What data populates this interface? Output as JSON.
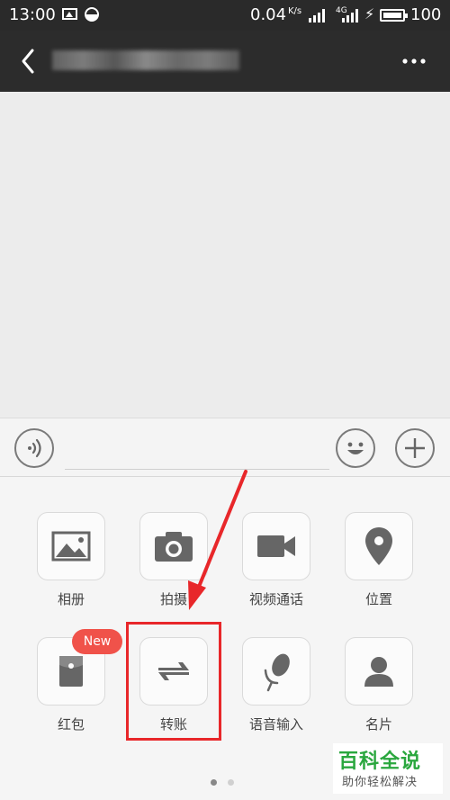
{
  "status_bar": {
    "time": "13:00",
    "speed": "0.04",
    "speed_unit": "K/s",
    "network": "4G",
    "battery": "100"
  },
  "header": {
    "back_icon": "chevron-left-icon",
    "more_icon": "more-horizontal-icon"
  },
  "input_bar": {
    "voice_icon": "voice-icon",
    "emoji_icon": "emoji-icon",
    "plus_icon": "plus-icon",
    "placeholder": ""
  },
  "apps": [
    {
      "label": "相册",
      "icon": "album-icon"
    },
    {
      "label": "拍摄",
      "icon": "camera-icon"
    },
    {
      "label": "视频通话",
      "icon": "video-call-icon"
    },
    {
      "label": "位置",
      "icon": "location-icon"
    },
    {
      "label": "红包",
      "icon": "red-packet-icon",
      "badge": "New"
    },
    {
      "label": "转账",
      "icon": "transfer-icon"
    },
    {
      "label": "语音输入",
      "icon": "microphone-icon"
    },
    {
      "label": "名片",
      "icon": "contact-card-icon"
    }
  ],
  "pager": {
    "current": 1,
    "total": 2
  },
  "watermark": {
    "title": "百科全说",
    "subtitle": "助你轻松解决"
  },
  "colors": {
    "header_bg": "#2c2c2c",
    "panel_bg": "#f5f5f5",
    "highlight": "#e8272a",
    "badge": "#f0524a",
    "watermark_green": "#2aa73e"
  }
}
